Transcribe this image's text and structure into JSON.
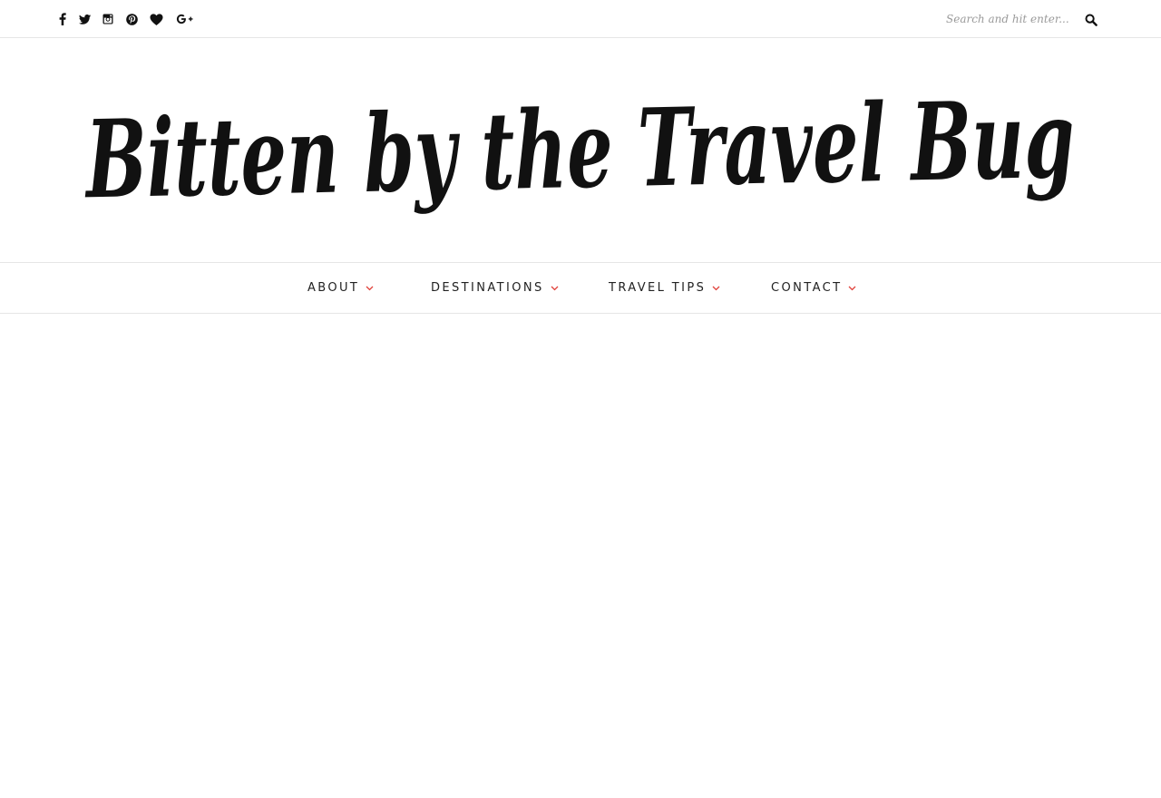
{
  "topbar": {
    "social_icons": [
      "facebook-icon",
      "twitter-icon",
      "instagram-icon",
      "pinterest-icon",
      "bloglovin-heart-icon",
      "google-plus-icon"
    ],
    "search": {
      "placeholder": "Search and hit enter...",
      "value": "",
      "button_icon": "search-icon"
    }
  },
  "header": {
    "site_title": "Bitten by the Travel Bug"
  },
  "nav": {
    "items": [
      {
        "label": "ABOUT"
      },
      {
        "label": "DESTINATIONS"
      },
      {
        "label": "TRAVEL TIPS"
      },
      {
        "label": "CONTACT"
      }
    ],
    "accent_color": "#e0413a"
  }
}
